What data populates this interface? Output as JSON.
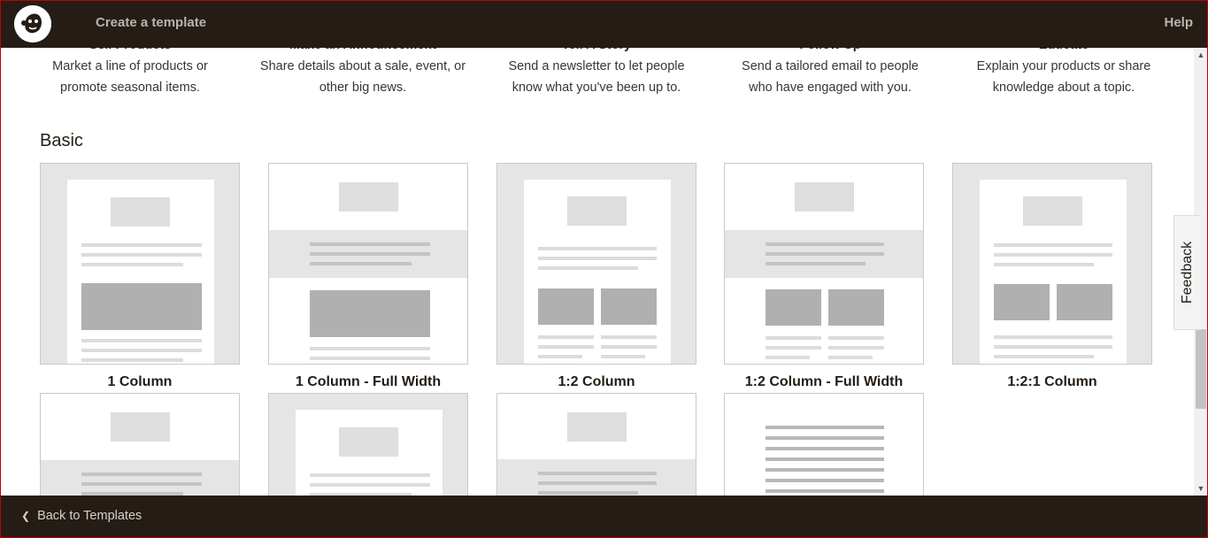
{
  "header": {
    "title": "Create a template",
    "help_label": "Help",
    "logo_icon": "mailchimp-logo-icon"
  },
  "categories": [
    {
      "title": "Sell Products",
      "desc1": "Market a line of products or",
      "desc2": "promote seasonal items."
    },
    {
      "title": "Make an Announcement",
      "desc1": "Share details about a sale, event, or",
      "desc2": "other big news."
    },
    {
      "title": "Tell A Story",
      "desc1": "Send a newsletter to let people",
      "desc2": "know what you've been up to."
    },
    {
      "title": "Follow Up",
      "desc1": "Send a tailored email to people",
      "desc2": "who have engaged with you."
    },
    {
      "title": "Educate",
      "desc1": "Explain your products or share",
      "desc2": "knowledge about a topic."
    }
  ],
  "section": {
    "title": "Basic"
  },
  "templates": [
    {
      "label": "1 Column"
    },
    {
      "label": "1 Column - Full Width"
    },
    {
      "label": "1:2 Column"
    },
    {
      "label": "1:2 Column - Full Width"
    },
    {
      "label": "1:2:1 Column"
    }
  ],
  "feedback": {
    "label": "Feedback"
  },
  "footer": {
    "back_label": "Back to Templates"
  },
  "colors": {
    "bar_bg": "#241c15",
    "frame": "#c00000"
  }
}
